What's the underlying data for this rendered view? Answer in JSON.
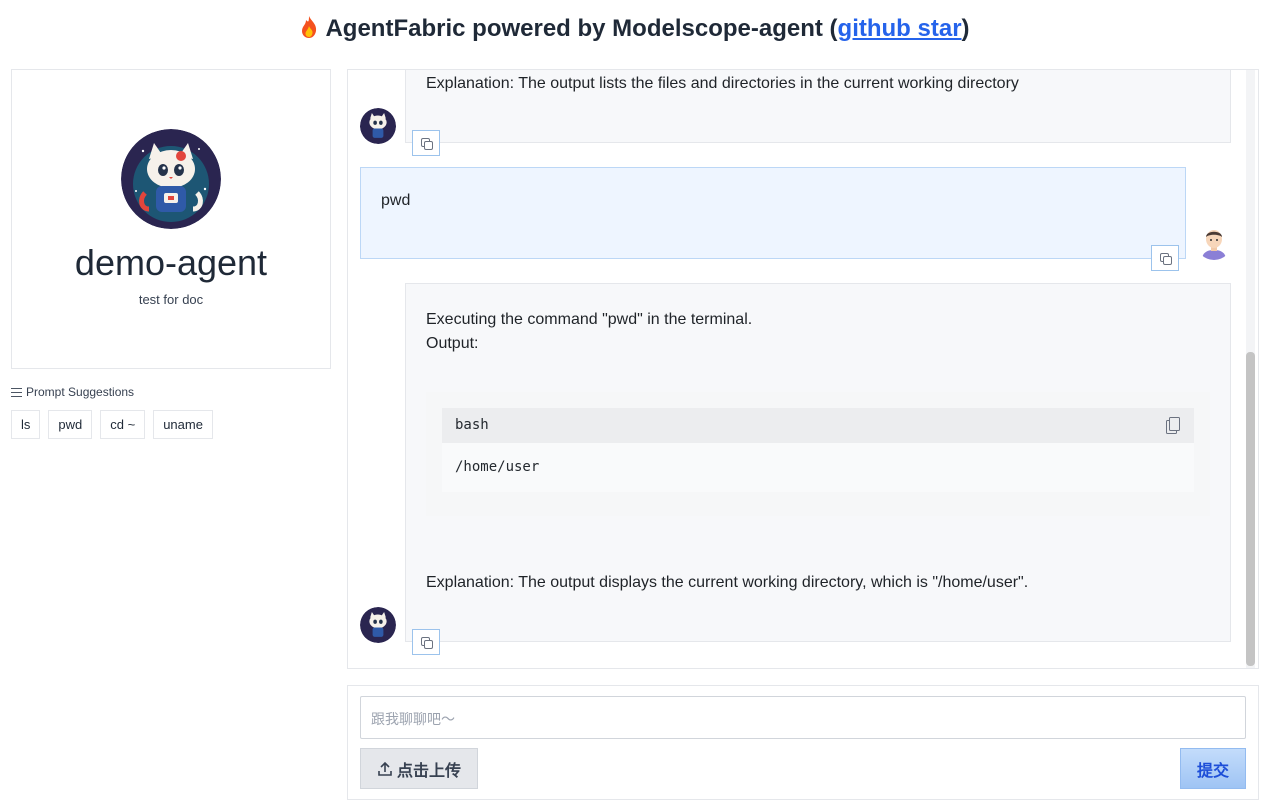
{
  "header": {
    "title_prefix": "AgentFabric powered by Modelscope-agent (",
    "link_text": "github star",
    "title_suffix": ")",
    "icon": "fire-icon"
  },
  "profile": {
    "name": "demo-agent",
    "description": "test for doc",
    "avatar": "cat-astronaut-avatar"
  },
  "suggestions": {
    "label": "Prompt Suggestions",
    "items": [
      "ls",
      "pwd",
      "cd ~",
      "uname"
    ]
  },
  "chat": {
    "messages": [
      {
        "role": "bot",
        "text": "Explanation: The output lists the files and directories in the current working directory"
      },
      {
        "role": "user",
        "text": "pwd"
      },
      {
        "role": "bot",
        "line1": "Executing the command \"pwd\" in the terminal.",
        "line2": "Output:",
        "code_lang": "bash",
        "code": "/home/user",
        "explanation": "Explanation: The output displays the current working directory, which is \"/home/user\"."
      }
    ]
  },
  "input": {
    "placeholder": "跟我聊聊吧～",
    "upload_label": "点击上传",
    "submit_label": "提交"
  }
}
